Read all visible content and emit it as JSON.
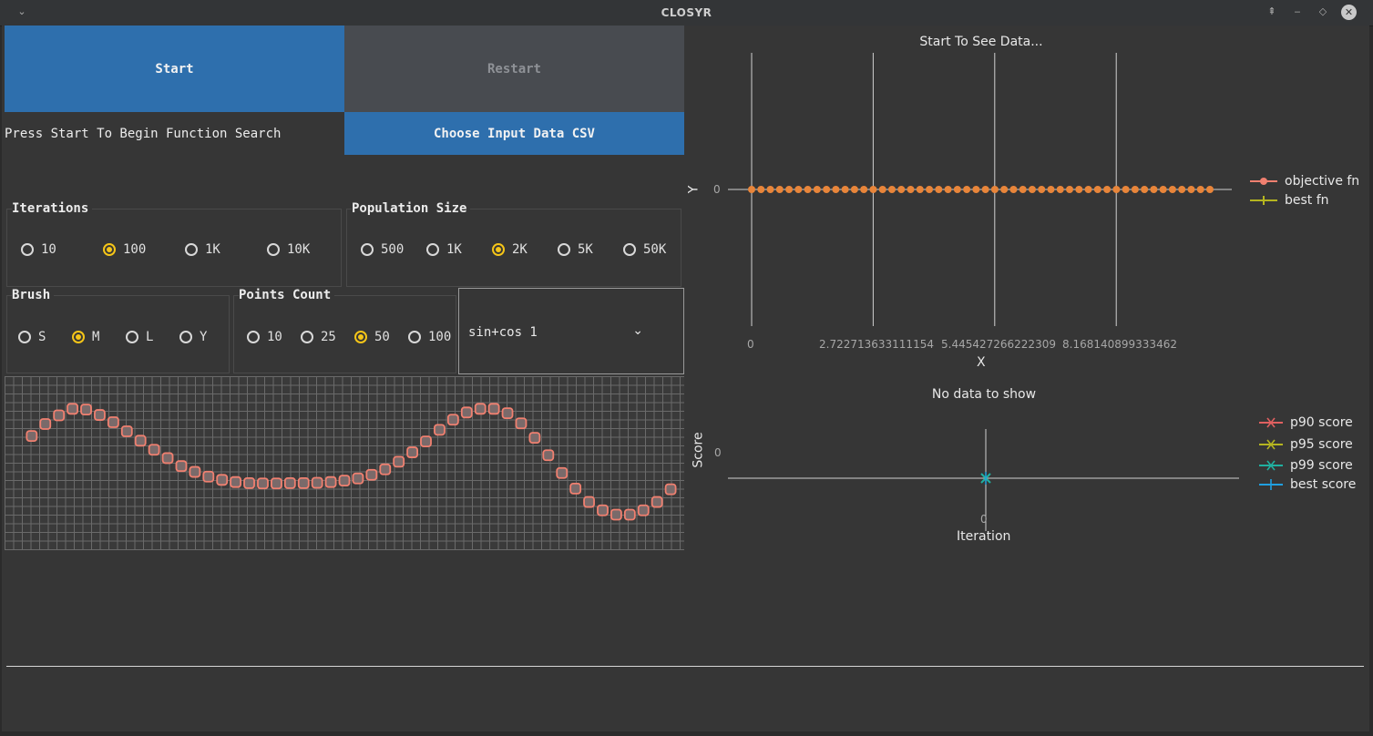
{
  "window": {
    "title": "CLOSYR"
  },
  "controls": {
    "start_label": "Start",
    "restart_label": "Restart",
    "status_text": "Press Start To Begin Function Search",
    "csv_label": "Choose Input Data CSV"
  },
  "iterations": {
    "title": "Iterations",
    "options": [
      "10",
      "100",
      "1K",
      "10K"
    ],
    "selected": "100"
  },
  "population": {
    "title": "Population Size",
    "options": [
      "500",
      "1K",
      "2K",
      "5K",
      "50K"
    ],
    "selected": "2K"
  },
  "brush": {
    "title": "Brush",
    "options": [
      "S",
      "M",
      "L",
      "Y"
    ],
    "selected": "M"
  },
  "points": {
    "title": "Points Count",
    "options": [
      "10",
      "25",
      "50",
      "100"
    ],
    "selected": "50"
  },
  "function_select": {
    "value": "sin+cos 1"
  },
  "colors": {
    "accent": "#2e6fad",
    "radio_selected": "#f5c518",
    "objective": "#f08070",
    "best_fn": "#b5b520",
    "p90": "#e06060",
    "p95": "#b5b520",
    "p99": "#20b0a0",
    "best_score": "#20a0e0"
  },
  "chart_data": [
    {
      "type": "line",
      "title": "Start To See Data...",
      "xlabel": "X",
      "ylabel": "Y",
      "x_ticks": [
        "0",
        "2.722713633111154",
        "5.445427266222309",
        "8.168140899333462"
      ],
      "y_ticks": [
        "0"
      ],
      "legend": "right",
      "series": [
        {
          "name": "objective fn",
          "values": [
            0,
            0,
            0,
            0,
            0,
            0,
            0,
            0,
            0,
            0,
            0,
            0,
            0,
            0,
            0,
            0,
            0,
            0,
            0,
            0,
            0,
            0,
            0,
            0,
            0,
            0,
            0,
            0,
            0,
            0,
            0,
            0,
            0,
            0,
            0,
            0,
            0,
            0,
            0,
            0,
            0,
            0,
            0,
            0,
            0,
            0,
            0,
            0,
            0,
            0
          ]
        },
        {
          "name": "best fn",
          "values": []
        }
      ],
      "xlim": [
        0,
        10.4
      ]
    },
    {
      "type": "line",
      "title": "No data to show",
      "xlabel": "Iteration",
      "ylabel": "Score",
      "x_ticks": [
        "0"
      ],
      "y_ticks": [
        "0"
      ],
      "legend": "right",
      "series": [
        {
          "name": "p90 score",
          "values": [
            0
          ]
        },
        {
          "name": "p95 score",
          "values": [
            0
          ]
        },
        {
          "name": "p99 score",
          "values": [
            0
          ]
        },
        {
          "name": "best score",
          "values": [
            0
          ]
        }
      ]
    }
  ],
  "drawing": {
    "points": [
      {
        "x": 0.4,
        "y": -0.05
      },
      {
        "x": 0.6,
        "y": 0.28
      },
      {
        "x": 0.8,
        "y": 0.52
      },
      {
        "x": 1.0,
        "y": 0.7
      },
      {
        "x": 1.2,
        "y": 0.68
      },
      {
        "x": 1.4,
        "y": 0.53
      },
      {
        "x": 1.6,
        "y": 0.33
      },
      {
        "x": 1.8,
        "y": 0.08
      },
      {
        "x": 2.0,
        "y": -0.18
      },
      {
        "x": 2.2,
        "y": -0.43
      },
      {
        "x": 2.4,
        "y": -0.66
      },
      {
        "x": 2.6,
        "y": -0.88
      },
      {
        "x": 2.8,
        "y": -1.04
      },
      {
        "x": 3.0,
        "y": -1.17
      },
      {
        "x": 3.2,
        "y": -1.26
      },
      {
        "x": 3.4,
        "y": -1.32
      },
      {
        "x": 3.6,
        "y": -1.35
      },
      {
        "x": 3.8,
        "y": -1.36
      },
      {
        "x": 4.0,
        "y": -1.36
      },
      {
        "x": 4.2,
        "y": -1.35
      },
      {
        "x": 4.4,
        "y": -1.35
      },
      {
        "x": 4.6,
        "y": -1.34
      },
      {
        "x": 4.8,
        "y": -1.32
      },
      {
        "x": 5.0,
        "y": -1.28
      },
      {
        "x": 5.2,
        "y": -1.22
      },
      {
        "x": 5.4,
        "y": -1.12
      },
      {
        "x": 5.6,
        "y": -0.97
      },
      {
        "x": 5.8,
        "y": -0.76
      },
      {
        "x": 6.0,
        "y": -0.5
      },
      {
        "x": 6.2,
        "y": -0.2
      },
      {
        "x": 6.4,
        "y": 0.12
      },
      {
        "x": 6.6,
        "y": 0.4
      },
      {
        "x": 6.8,
        "y": 0.6
      },
      {
        "x": 7.0,
        "y": 0.7
      },
      {
        "x": 7.2,
        "y": 0.7
      },
      {
        "x": 7.4,
        "y": 0.58
      },
      {
        "x": 7.6,
        "y": 0.3
      },
      {
        "x": 7.8,
        "y": -0.1
      },
      {
        "x": 8.0,
        "y": -0.58
      },
      {
        "x": 8.2,
        "y": -1.07
      },
      {
        "x": 8.4,
        "y": -1.5
      },
      {
        "x": 8.6,
        "y": -1.87
      },
      {
        "x": 8.8,
        "y": -2.1
      },
      {
        "x": 9.0,
        "y": -2.22
      },
      {
        "x": 9.2,
        "y": -2.22
      },
      {
        "x": 9.4,
        "y": -2.1
      },
      {
        "x": 9.6,
        "y": -1.87
      },
      {
        "x": 9.8,
        "y": -1.52
      }
    ]
  }
}
